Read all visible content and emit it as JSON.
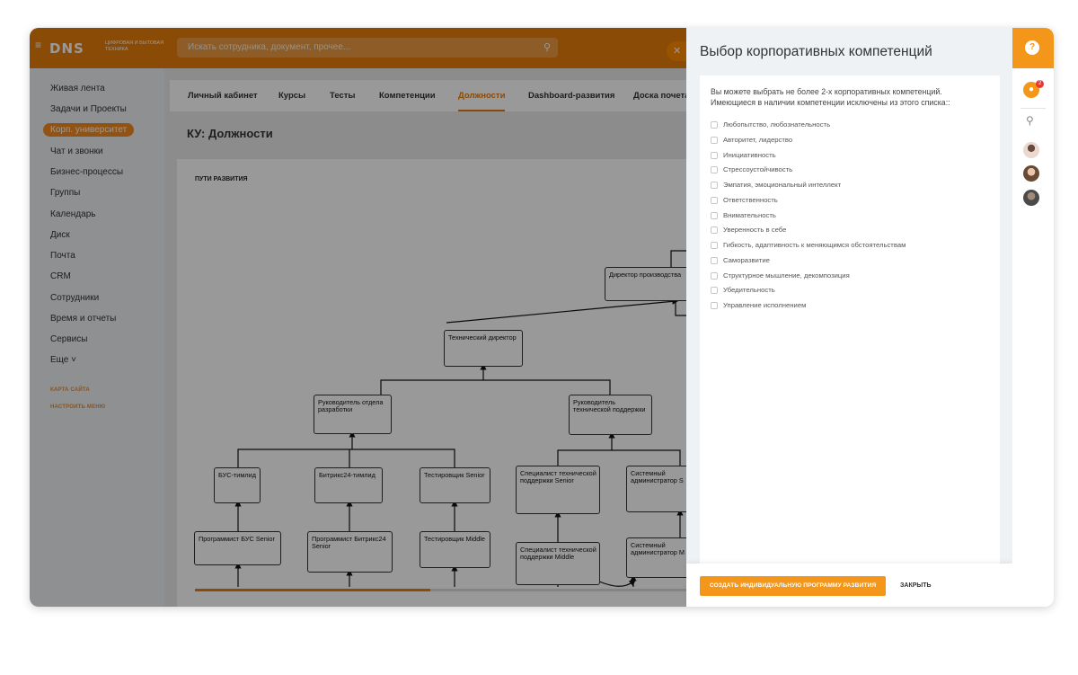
{
  "topbar": {
    "logo": "DNS",
    "logo_subtitle": "ЦИФРОВАЯ И БЫТОВАЯ ТЕХНИКА",
    "search_placeholder": "Искать сотрудника, документ, прочее..."
  },
  "left_menu": {
    "items": [
      "Живая лента",
      "Задачи и Проекты",
      "Корп. университет",
      "Чат и звонки",
      "Бизнес-процессы",
      "Группы",
      "Календарь",
      "Диск",
      "Почта",
      "CRM",
      "Сотрудники",
      "Время и отчеты",
      "Сервисы",
      "Еще ˅"
    ],
    "active": "Корп. университет",
    "links": [
      "КАРТА САЙТА",
      "НАСТРОИТЬ МЕНЮ"
    ]
  },
  "tabs": [
    "Личный кабинет",
    "Курсы",
    "Тесты",
    "Компетенции",
    "Должности",
    "Dashboard-развития",
    "Доска почета"
  ],
  "active_tab": "Должности",
  "page_title": "КУ: Должности",
  "org_chart": {
    "title": "ПУТИ РАЗВИТИЯ",
    "nodes": {
      "director": "Директор производства",
      "tech_director": "Технический директор",
      "dev_head": "Руководитель отдела разработки",
      "support_head": "Руководитель технической поддержки",
      "bus_teamlead": "БУС-тимлид",
      "b24_teamlead": "Битрикс24-тимлид",
      "tester_senior": "Тестировщик Senior",
      "support_senior": "Специалист технической поддержки Senior",
      "sysadmin_s": "Системный администратор S",
      "prog_bus_senior": "Программист БУС Senior",
      "prog_b24_senior": "Программист Битрикс24 Senior",
      "tester_middle": "Тестировщик Middle",
      "support_middle": "Специалист технической поддержки Middle",
      "sysadmin_m": "Системный администратор M"
    }
  },
  "slider": {
    "title": "Выбор корпоративных компетенций",
    "intro_line1": "Вы можете выбрать не более 2-х корпоративных компетенций.",
    "intro_line2": "Имеющиеся в наличии компетенции исключены из этого списка::",
    "competencies": [
      "Любопытство, любознательность",
      "Авторитет, лидерство",
      "Инициативность",
      "Стрессоустойчивость",
      "Эмпатия, эмоциональный интеллект",
      "Ответственность",
      "Внимательность",
      "Уверенность в себе",
      "Гибкость, адаптивность к меняющимся обстоятельствам",
      "Саморазвитие",
      "Структурное мышление, декомпозиция",
      "Убедительность",
      "Управление исполнением"
    ],
    "create_button": "СОЗДАТЬ ИНДИВИДУАЛЬНУЮ ПРОГРАММУ РАЗВИТИЯ",
    "close_button": "ЗАКРЫТЬ"
  },
  "right_panel": {
    "help_symbol": "?",
    "notification_count": "2"
  },
  "colors": {
    "accent": "#e67d0c",
    "button": "#f39619",
    "overlay": "#000000",
    "badge": "#e53935"
  }
}
